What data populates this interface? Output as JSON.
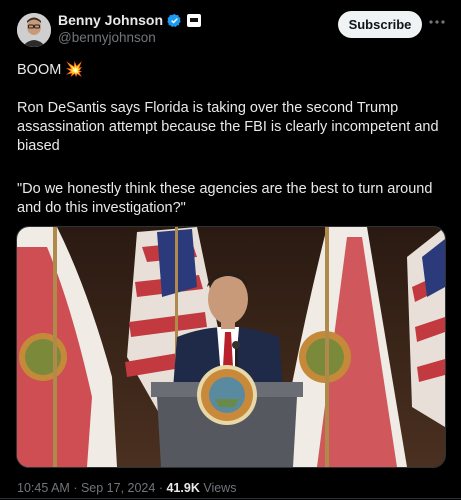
{
  "author": {
    "name": "Benny Johnson",
    "handle": "@bennyjohnson",
    "verified_color": "#1d9bf0"
  },
  "actions": {
    "subscribe_label": "Subscribe",
    "more_icon": "more-horizontal-icon"
  },
  "post": {
    "line1": "BOOM",
    "emoji": "💥",
    "paragraph": "Ron DeSantis says Florida is taking over the second Trump assassination attempt because the FBI is clearly incompetent and biased",
    "quote": "\"Do we honestly think these agencies are the best to turn around and do this investigation?\""
  },
  "footer": {
    "time": "10:45 AM",
    "separator": "·",
    "date": "Sep 17, 2024",
    "views_count": "41.9K",
    "views_label": "Views"
  }
}
